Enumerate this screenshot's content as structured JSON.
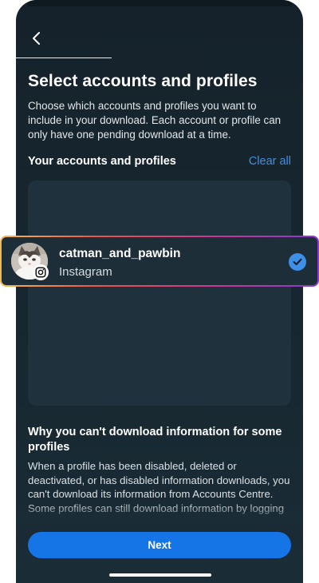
{
  "header": {
    "title": "Select accounts and profiles",
    "description": "Choose which accounts and profiles you want to include in your download. Each account or profile can only have one pending download at a time."
  },
  "accounts_section": {
    "heading": "Your accounts and profiles",
    "clear_all_label": "Clear all",
    "items": [
      {
        "username": "catman_and_pawbin",
        "platform": "Instagram",
        "platform_icon": "instagram-icon",
        "selected": true
      }
    ]
  },
  "info_section": {
    "heading": "Why you can't download information for some profiles",
    "body": "When a profile has been disabled, deleted or deactivated, or has disabled information downloads, you can't download its information from Accounts Centre. Some profiles can still download information by logging into Facebook to"
  },
  "footer": {
    "next_label": "Next"
  },
  "colors": {
    "background": "#172730",
    "panel": "#1f313c",
    "accent_blue": "#1574e6",
    "link_blue": "#3d8fe8"
  }
}
